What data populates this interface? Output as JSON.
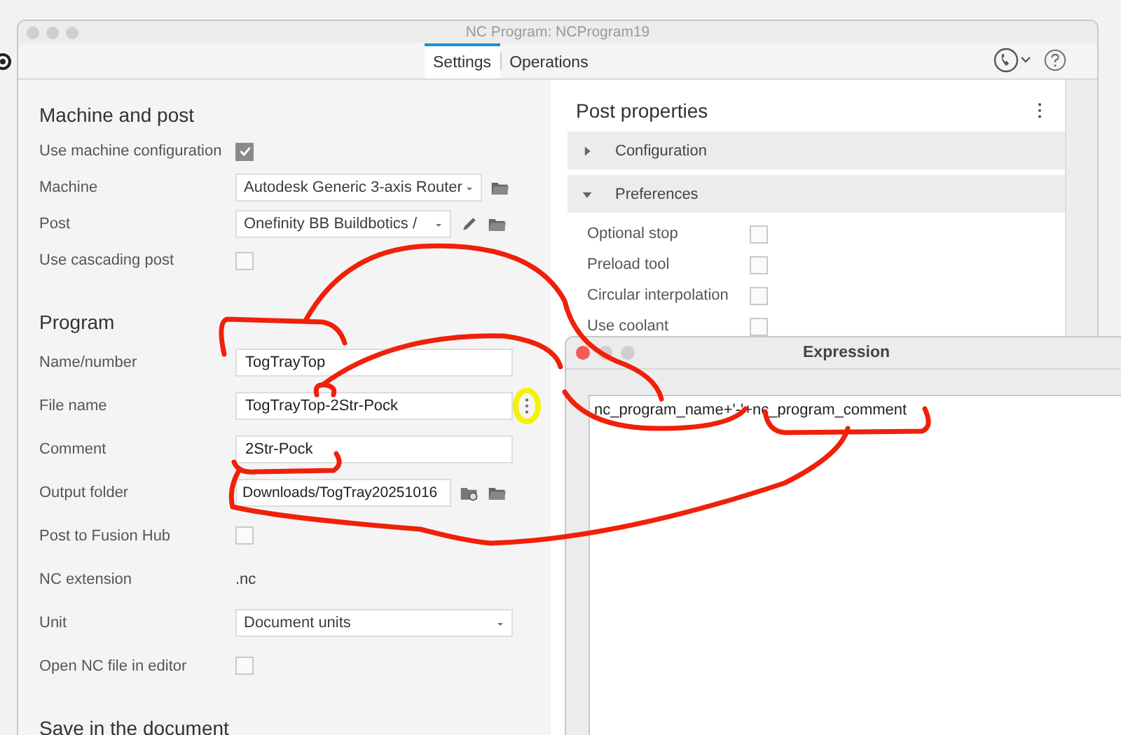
{
  "window": {
    "title": "NC Program: NCProgram19"
  },
  "tabs": [
    {
      "label": "Settings",
      "selected": true
    },
    {
      "label": "Operations",
      "selected": false
    }
  ],
  "machine_and_post": {
    "heading": "Machine and post",
    "rows": [
      {
        "kind": "checkbox",
        "label": "Use machine configuration",
        "checked": true
      },
      {
        "kind": "select-browse",
        "label": "Machine",
        "value": "Autodesk Generic 3-axis Router"
      },
      {
        "kind": "select-edit-browse",
        "label": "Post",
        "value": "Onefinity BB Buildbotics /"
      },
      {
        "kind": "checkbox",
        "label": "Use cascading post",
        "checked": false
      }
    ]
  },
  "program": {
    "heading": "Program",
    "rows": [
      {
        "kind": "text",
        "label": "Name/number",
        "value": "TogTrayTop"
      },
      {
        "kind": "text-expression",
        "label": "File name",
        "value": "TogTrayTop-2Str-Pock"
      },
      {
        "kind": "text",
        "label": "Comment",
        "value": "2Str-Pock"
      },
      {
        "kind": "path-browse",
        "label": "Output folder",
        "value": "Downloads/TogTray20251016"
      },
      {
        "kind": "checkbox",
        "label": "Post to Fusion Hub",
        "checked": false
      },
      {
        "kind": "value",
        "label": "NC extension",
        "value": ".nc"
      },
      {
        "kind": "select",
        "label": "Unit",
        "value": "Document units"
      },
      {
        "kind": "checkbox",
        "label": "Open NC file in editor",
        "checked": false
      }
    ]
  },
  "save_section": {
    "heading": "Save in the document"
  },
  "post_properties": {
    "title": "Post properties",
    "groups": [
      {
        "label": "Configuration",
        "expanded": false
      },
      {
        "label": "Preferences",
        "expanded": true
      }
    ],
    "options": [
      {
        "label": "Optional stop",
        "checked": false
      },
      {
        "label": "Preload tool",
        "checked": false
      },
      {
        "label": "Circular interpolation",
        "checked": false
      },
      {
        "label": "Use coolant",
        "checked": false
      }
    ]
  },
  "expression_window": {
    "title": "Expression",
    "value": "nc_program_name+'-'+nc_program_comment"
  }
}
